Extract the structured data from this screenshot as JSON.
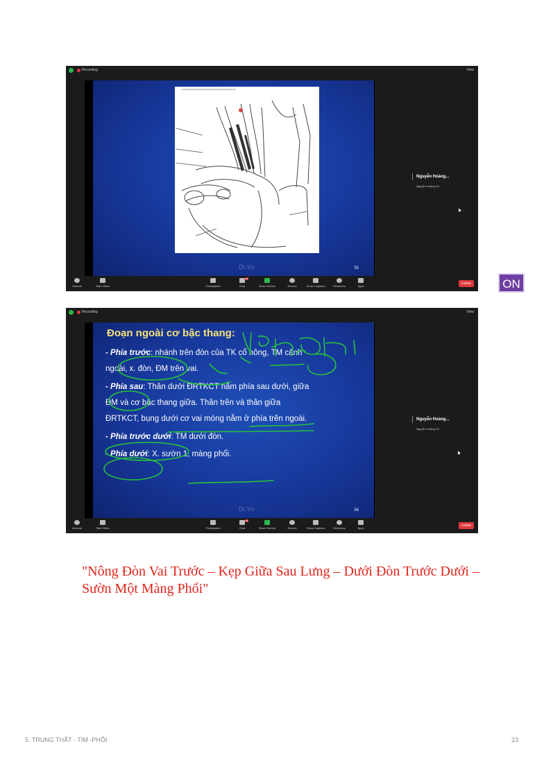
{
  "zoom": {
    "recording_label": "Recording",
    "view_label": "View",
    "participant_name": "Nguyễn Hoàng...",
    "participant_sub": "Nguyễn Hoàng Vũ",
    "toolbar": {
      "unmute": "Unmute",
      "start_video": "Start Video",
      "participants": "Participants",
      "participants_count": "324",
      "chat": "Chat",
      "chat_badge": "99",
      "share_screen": "Share Screen",
      "record": "Record",
      "show_captions": "Show Captions",
      "reactions": "Reactions",
      "apps": "Apps",
      "leave": "Leave"
    }
  },
  "slide1": {
    "watermark": "Dr.Vu",
    "page_number": "55"
  },
  "slide2": {
    "title": "Đoạn ngoài cơ bậc thang:",
    "lines": [
      {
        "bold": "- Phía trước",
        "text": ": nhánh trên đòn của TK cổ nông, TM cảnh"
      },
      {
        "bold": "",
        "text": "ngoài, x. đòn, ĐM trên vai."
      },
      {
        "bold": "- Phía sau",
        "text": ": Thân dưới ĐRTKCT nằm phía sau dưới, giữa"
      },
      {
        "bold": "",
        "text": "ĐM và cơ bậc thang giữa. Thân trên và thân giữa"
      },
      {
        "bold": "",
        "text": "ĐRTKCT, bụng dưới cơ vai móng nằm ở phía trên ngoài."
      },
      {
        "bold": "- Phía trước dưới",
        "text": ": TM dưới đòn."
      },
      {
        "bold": "- Phía dưới",
        "text": ": X. sườn 1, màng phổi."
      }
    ],
    "watermark": "Dr.Vu",
    "page_number": "56",
    "ink_color": "#27c23c"
  },
  "on_badge": "ON",
  "mnemonic": "\"Nông Đòn Vai Trước – Kẹp Giữa Sau Lưng – Dưới Đòn Trước Dưới – Sườn Một Màng Phổi\"",
  "footer": {
    "section": "5. TRUNG THẤT - TIM -PHỔI",
    "page": "23"
  }
}
